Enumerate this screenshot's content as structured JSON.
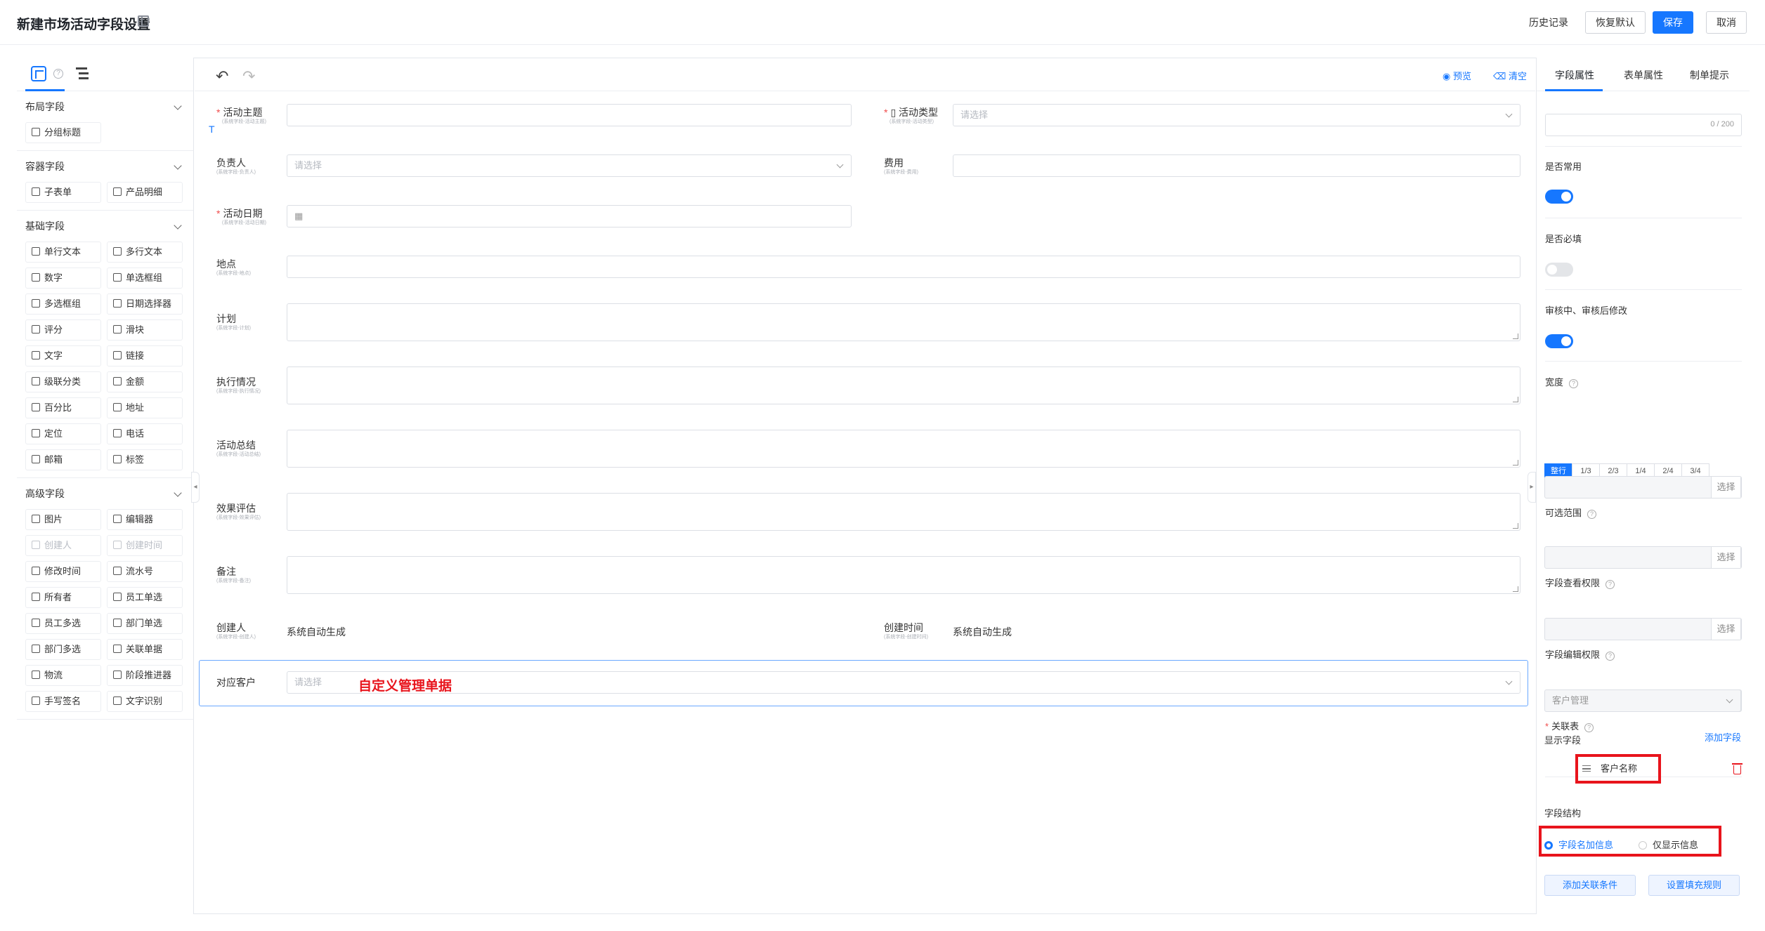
{
  "header": {
    "title": "新建市场活动字段设置",
    "history": "历史记录",
    "restore": "恢复默认",
    "save": "保存",
    "cancel": "取消"
  },
  "left_panel": {
    "groups": [
      {
        "name": "布局字段",
        "items": [
          {
            "label": "分组标题",
            "disabled": false
          }
        ]
      },
      {
        "name": "容器字段",
        "items": [
          {
            "label": "子表单",
            "disabled": false
          },
          {
            "label": "产品明细",
            "disabled": false
          }
        ]
      },
      {
        "name": "基础字段",
        "items": [
          {
            "label": "单行文本",
            "disabled": false
          },
          {
            "label": "多行文本",
            "disabled": false
          },
          {
            "label": "数字",
            "disabled": false
          },
          {
            "label": "单选框组",
            "disabled": false
          },
          {
            "label": "多选框组",
            "disabled": false
          },
          {
            "label": "日期选择器",
            "disabled": false
          },
          {
            "label": "评分",
            "disabled": false
          },
          {
            "label": "滑块",
            "disabled": false
          },
          {
            "label": "文字",
            "disabled": false
          },
          {
            "label": "链接",
            "disabled": false
          },
          {
            "label": "级联分类",
            "disabled": false
          },
          {
            "label": "金额",
            "disabled": false
          },
          {
            "label": "百分比",
            "disabled": false
          },
          {
            "label": "地址",
            "disabled": false
          },
          {
            "label": "定位",
            "disabled": false
          },
          {
            "label": "电话",
            "disabled": false
          },
          {
            "label": "邮箱",
            "disabled": false
          },
          {
            "label": "标签",
            "disabled": false
          }
        ]
      },
      {
        "name": "高级字段",
        "items": [
          {
            "label": "图片",
            "disabled": false
          },
          {
            "label": "编辑器",
            "disabled": false
          },
          {
            "label": "创建人",
            "disabled": true
          },
          {
            "label": "创建时间",
            "disabled": true
          },
          {
            "label": "修改时间",
            "disabled": false
          },
          {
            "label": "流水号",
            "disabled": false
          },
          {
            "label": "所有者",
            "disabled": false
          },
          {
            "label": "员工单选",
            "disabled": false
          },
          {
            "label": "员工多选",
            "disabled": false
          },
          {
            "label": "部门单选",
            "disabled": false
          },
          {
            "label": "部门多选",
            "disabled": false
          },
          {
            "label": "关联单据",
            "disabled": false
          },
          {
            "label": "物流",
            "disabled": false
          },
          {
            "label": "阶段推进器",
            "disabled": false
          },
          {
            "label": "手写签名",
            "disabled": false
          },
          {
            "label": "文字识别",
            "disabled": false
          }
        ]
      }
    ]
  },
  "canvas": {
    "toolbar": {
      "preview": "预览",
      "clear": "清空"
    },
    "fields": {
      "theme": {
        "label": "活动主题",
        "sub": "(系统字段-活动主题)"
      },
      "type": {
        "label": "活动类型",
        "sub": "(系统字段-活动类型)",
        "placeholder": "请选择"
      },
      "owner": {
        "label": "负责人",
        "sub": "(系统字段-负责人)",
        "placeholder": "请选择"
      },
      "cost": {
        "label": "费用",
        "sub": "(系统字段-费用)"
      },
      "date": {
        "label": "活动日期",
        "sub": "(系统字段-活动日期)"
      },
      "place": {
        "label": "地点",
        "sub": "(系统字段-地点)"
      },
      "plan": {
        "label": "计划",
        "sub": "(系统字段-计划)"
      },
      "exec": {
        "label": "执行情况",
        "sub": "(系统字段-执行情况)"
      },
      "summary": {
        "label": "活动总结",
        "sub": "(系统字段-活动总结)"
      },
      "eval": {
        "label": "效果评估",
        "sub": "(系统字段-效果评估)"
      },
      "note": {
        "label": "备注",
        "sub": "(系统字段-备注)"
      },
      "creator": {
        "label": "创建人",
        "sub": "(系统字段-创建人)",
        "value": "系统自动生成"
      },
      "created": {
        "label": "创建时间",
        "sub": "(系统字段-创建时间)",
        "value": "系统自动生成"
      },
      "customer": {
        "label": "对应客户",
        "placeholder": "请选择"
      }
    },
    "annotation": "自定义管理单据",
    "t_marker": "T"
  },
  "right_panel": {
    "tabs": [
      "字段属性",
      "表单属性",
      "制单提示"
    ],
    "counter": "0 / 200",
    "common": "是否常用",
    "required": "是否必填",
    "edit_after": "审核中、审核后修改",
    "width": "宽度",
    "width_options": [
      "整行",
      "1/3",
      "2/3",
      "1/4",
      "2/4",
      "3/4"
    ],
    "range": "可选范围",
    "view_perm": "字段查看权限",
    "edit_perm": "字段编辑权限",
    "select_btn": "选择",
    "relation_table": "关联表",
    "relation_value": "客户管理",
    "display_fields": "显示字段",
    "add_field": "添加字段",
    "display_item": "客户名称",
    "structure": "字段结构",
    "radio_1": "字段名加信息",
    "radio_2": "仅显示信息",
    "add_condition": "添加关联条件",
    "fill_rule": "设置填充规则"
  }
}
